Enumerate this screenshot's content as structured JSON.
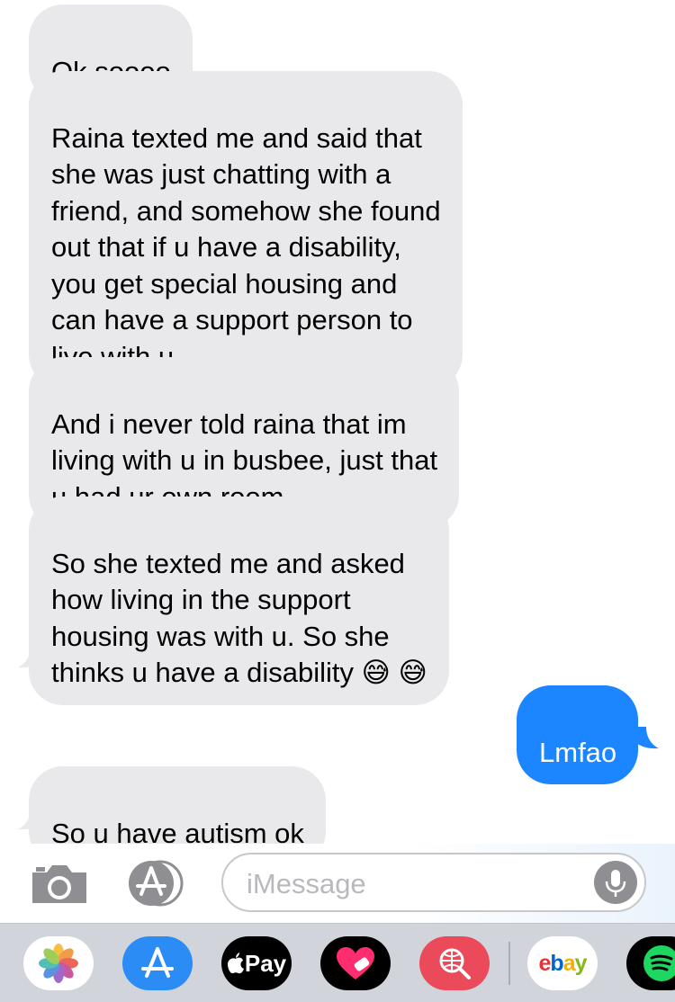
{
  "messages": [
    {
      "direction": "incoming",
      "text": "Ok soooo"
    },
    {
      "direction": "incoming",
      "text": "Raina texted me and said that\nshe was just chatting with a\nfriend, and somehow she found\nout that if u have a disability,\nyou get special housing and\ncan have a support person to\nlive with u"
    },
    {
      "direction": "incoming",
      "text": "And i never told raina that im\nliving with u in busbee, just that\nu had ur own room"
    },
    {
      "direction": "incoming",
      "text": "So she texted me and asked\nhow living in the support\nhousing was with u. So she\nthinks u have a disability 😅 😅"
    },
    {
      "direction": "outgoing",
      "text": "Lmfao"
    },
    {
      "direction": "incoming",
      "text": "So u have autism ok"
    }
  ],
  "input": {
    "placeholder": "iMessage"
  },
  "app_drawer": {
    "apps": [
      "photos",
      "app-store",
      "apple-pay",
      "digital-touch",
      "search-images",
      "ebay",
      "spotify"
    ],
    "apple_pay_label": "Pay",
    "ebay_label": "ebay"
  },
  "colors": {
    "incoming_bubble": "#e9e9eb",
    "outgoing_bubble": "#1b86ff",
    "drawer": "#d1d5db"
  }
}
